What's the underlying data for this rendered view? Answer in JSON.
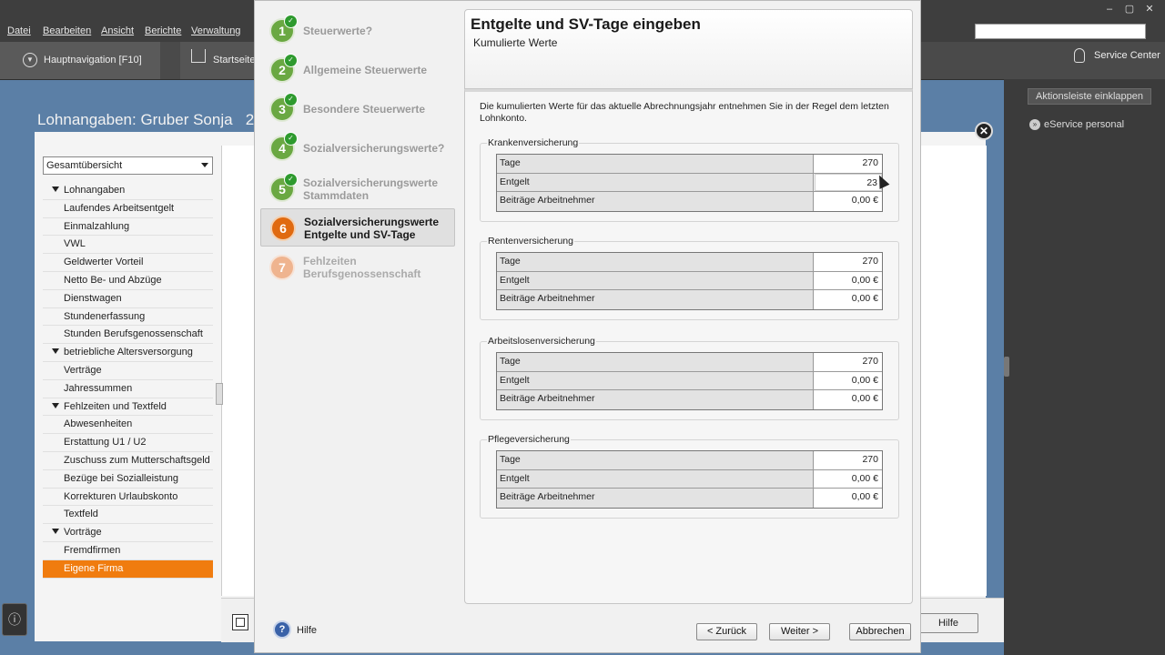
{
  "menu": [
    "Datei",
    "Bearbeiten",
    "Ansicht",
    "Berichte",
    "Verwaltung"
  ],
  "window_controls": [
    "–",
    "▢",
    "✕"
  ],
  "nav": {
    "hauptnavigation": "Hauptnavigation [F10]",
    "startseite": "Startseite",
    "service_center": "Service Center"
  },
  "right_pane": {
    "collapse": "Aktionsleiste einklappen",
    "eservice": "eService personal"
  },
  "lohn": {
    "title": "Lohnangaben: Gruber Sonja",
    "title_suffix": "2",
    "dropdown": "Gesamtübersicht",
    "hilfe": "Hilfe",
    "tree": [
      {
        "label": "Lohnangaben",
        "group": true
      },
      {
        "label": "Laufendes Arbeitsentgelt"
      },
      {
        "label": "Einmalzahlung"
      },
      {
        "label": "VWL"
      },
      {
        "label": "Geldwerter Vorteil"
      },
      {
        "label": "Netto Be- und Abzüge"
      },
      {
        "label": "Dienstwagen"
      },
      {
        "label": "Stundenerfassung"
      },
      {
        "label": "Stunden Berufsgenossenschaft"
      },
      {
        "label": "betriebliche Altersversorgung",
        "group": true
      },
      {
        "label": "Verträge"
      },
      {
        "label": "Jahressummen"
      },
      {
        "label": "Fehlzeiten und Textfeld",
        "group": true
      },
      {
        "label": "Abwesenheiten"
      },
      {
        "label": "Erstattung U1 / U2"
      },
      {
        "label": "Zuschuss zum Mutterschaftsgeld"
      },
      {
        "label": "Bezüge bei Sozialleistung"
      },
      {
        "label": "Korrekturen Urlaubskonto"
      },
      {
        "label": "Textfeld"
      },
      {
        "label": "Vorträge",
        "group": true
      },
      {
        "label": "Fremdfirmen"
      },
      {
        "label": "Eigene Firma",
        "selected": true
      }
    ]
  },
  "steps": [
    {
      "num": "1",
      "label": "Steuerwerte?",
      "state": "done"
    },
    {
      "num": "2",
      "label": "Allgemeine Steuerwerte",
      "state": "done"
    },
    {
      "num": "3",
      "label": "Besondere Steuerwerte",
      "state": "done"
    },
    {
      "num": "4",
      "label": "Sozialversicherungswerte?",
      "state": "done"
    },
    {
      "num": "5",
      "label": "Sozialversicherungswerte\nStammdaten",
      "state": "done"
    },
    {
      "num": "6",
      "label": "Sozialversicherungswerte\nEntgelte und SV-Tage",
      "state": "active"
    },
    {
      "num": "7",
      "label": "Fehlzeiten\nBerufsgenossenschaft",
      "state": "future"
    }
  ],
  "panel": {
    "title": "Entgelte und SV-Tage eingeben",
    "subtitle": "Kumulierte Werte",
    "description": "Die kumulierten Werte für das aktuelle Abrechnungsjahr entnehmen Sie in der Regel dem letzten Lohnkonto."
  },
  "groups": [
    {
      "title": "Krankenversicherung",
      "rows": [
        {
          "label": "Tage",
          "value": "270"
        },
        {
          "label": "Entgelt",
          "value": "23",
          "editing": true
        },
        {
          "label": "Beiträge Arbeitnehmer",
          "value": "0,00  €"
        }
      ]
    },
    {
      "title": "Rentenversicherung",
      "rows": [
        {
          "label": "Tage",
          "value": "270"
        },
        {
          "label": "Entgelt",
          "value": "0,00  €"
        },
        {
          "label": "Beiträge Arbeitnehmer",
          "value": "0,00  €"
        }
      ]
    },
    {
      "title": "Arbeitslosenversicherung",
      "rows": [
        {
          "label": "Tage",
          "value": "270"
        },
        {
          "label": "Entgelt",
          "value": "0,00  €"
        },
        {
          "label": "Beiträge Arbeitnehmer",
          "value": "0,00  €"
        }
      ]
    },
    {
      "title": "Pflegeversicherung",
      "rows": [
        {
          "label": "Tage",
          "value": "270"
        },
        {
          "label": "Entgelt",
          "value": "0,00  €"
        },
        {
          "label": "Beiträge Arbeitnehmer",
          "value": "0,00  €"
        }
      ]
    }
  ],
  "footer": {
    "help": "Hilfe",
    "back": "< Zurück",
    "next": "Weiter >",
    "cancel": "Abbrechen"
  }
}
